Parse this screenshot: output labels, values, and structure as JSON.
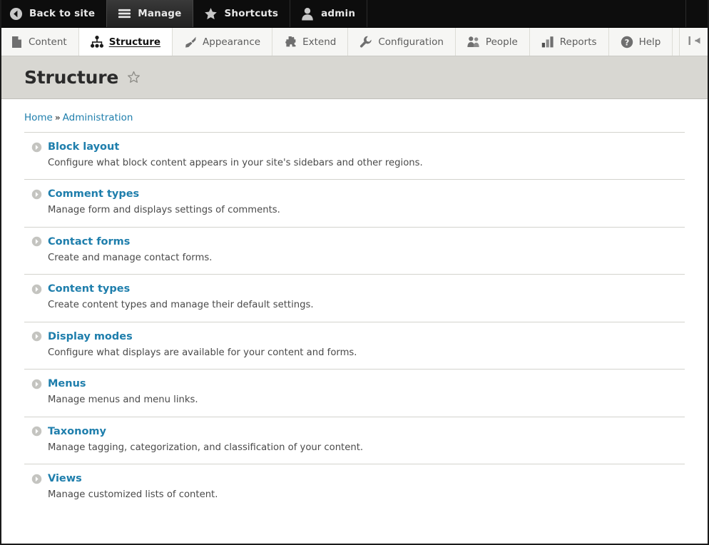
{
  "toolbar": {
    "items": [
      {
        "label": "Back to site",
        "icon": "back-arrow-circle-icon",
        "active": false
      },
      {
        "label": "Manage",
        "icon": "hamburger-menu-icon",
        "active": true
      },
      {
        "label": "Shortcuts",
        "icon": "star-icon",
        "active": false
      },
      {
        "label": "admin",
        "icon": "user-avatar-icon",
        "active": false
      }
    ]
  },
  "admin_tabs": {
    "items": [
      {
        "label": "Content",
        "icon": "document-icon",
        "active": false
      },
      {
        "label": "Structure",
        "icon": "sitemap-icon",
        "active": true
      },
      {
        "label": "Appearance",
        "icon": "paintbrush-icon",
        "active": false
      },
      {
        "label": "Extend",
        "icon": "puzzle-piece-icon",
        "active": false
      },
      {
        "label": "Configuration",
        "icon": "wrench-icon",
        "active": false
      },
      {
        "label": "People",
        "icon": "people-icon",
        "active": false
      },
      {
        "label": "Reports",
        "icon": "bar-chart-icon",
        "active": false
      },
      {
        "label": "Help",
        "icon": "question-mark-circle-icon",
        "active": false
      }
    ],
    "orientation_toggle_icon": "collapse-to-left-icon"
  },
  "header": {
    "title": "Structure",
    "shortcut_star_icon": "star-outline-icon"
  },
  "breadcrumb": {
    "items": [
      "Home",
      "Administration"
    ],
    "separator": "»"
  },
  "admin_list": {
    "bullet_icon": "chevron-right-circle-icon",
    "items": [
      {
        "title": "Block layout",
        "description": "Configure what block content appears in your site's sidebars and other regions."
      },
      {
        "title": "Comment types",
        "description": "Manage form and displays settings of comments."
      },
      {
        "title": "Contact forms",
        "description": "Create and manage contact forms."
      },
      {
        "title": "Content types",
        "description": "Create content types and manage their default settings."
      },
      {
        "title": "Display modes",
        "description": "Configure what displays are available for your content and forms."
      },
      {
        "title": "Menus",
        "description": "Manage menus and menu links."
      },
      {
        "title": "Taxonomy",
        "description": "Manage tagging, categorization, and classification of your content."
      },
      {
        "title": "Views",
        "description": "Manage customized lists of content."
      }
    ]
  },
  "colors": {
    "toolbar_background": "#0d0d0d",
    "toolbar_active": "#2e2e2e",
    "admin_tabs_background": "#f6f6f4",
    "title_band_background": "#d8d7d2",
    "link_blue": "#1e7eac",
    "body_text": "#4a4a4a",
    "divider": "#d3d3cd"
  }
}
